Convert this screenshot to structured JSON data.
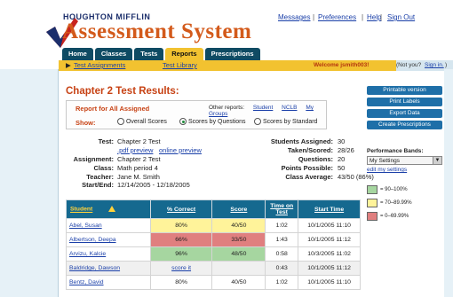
{
  "brand": {
    "small": "HOUGHTON MIFFLIN",
    "big": "Assessment System"
  },
  "top_links": {
    "messages": "Messages",
    "preferences": "Preferences",
    "help": "Help",
    "sign_out": "Sign Out",
    "separator": "|"
  },
  "tabs": [
    {
      "label": "Home"
    },
    {
      "label": "Classes"
    },
    {
      "label": "Tests"
    },
    {
      "label": "Reports"
    },
    {
      "label": "Prescriptions"
    }
  ],
  "subnav": {
    "test_assignments": "Test Assignments",
    "test_library": "Test Library",
    "welcome": "Welcome jsmith003!",
    "not_you_prefix": "(Not you?",
    "sign_in": "Sign in.",
    "not_you_suffix": ")"
  },
  "page_title": "Chapter 2 Test Results:",
  "report_box": {
    "title": "Report for All Assigned",
    "other_reports_label": "Other reports:",
    "other_reports": [
      "Student",
      "NCLB",
      "My Groups"
    ],
    "show_label": "Show:",
    "options": [
      "Overall Scores",
      "Scores by Questions",
      "Scores by Standard"
    ],
    "selected": "Scores by Questions"
  },
  "actions": [
    "Printable version",
    "Print Labels",
    "Export Data",
    "Create Prescriptions"
  ],
  "info_left": {
    "test_label": "Test:",
    "test_value": "Chapter 2 Test",
    "pdf_preview": ".pdf preview",
    "online_preview": "online preview",
    "assignment_label": "Assignment:",
    "assignment_value": "Chapter 2 Test",
    "class_label": "Class:",
    "class_value": "Math period 4",
    "teacher_label": "Teacher:",
    "teacher_value": "Jane M. Smith",
    "dates_label": "Start/End:",
    "dates_value": "12/14/2005 - 12/18/2005"
  },
  "info_right": {
    "assigned_label": "Students Assigned:",
    "assigned_value": "30",
    "taken_label": "Taken/Scored:",
    "taken_value": "28/26",
    "questions_label": "Questions:",
    "questions_value": "20",
    "points_label": "Points Possible:",
    "points_value": "50",
    "average_label": "Class Average:",
    "average_value": "43/50 (86%)"
  },
  "performance": {
    "title": "Performance Bands:",
    "selected": "My Settings",
    "edit": "edit my settings",
    "bands": [
      {
        "label": "= 90–100%",
        "color": "#a6d6a0"
      },
      {
        "label": "= 70–89.99%",
        "color": "#fff39a"
      },
      {
        "label": "= 0–69.99%",
        "color": "#e07f7f"
      }
    ]
  },
  "table": {
    "headers": [
      "Student",
      "% Correct",
      "Score",
      "Time on Test",
      "Start Time"
    ],
    "rows": [
      {
        "student": "Abel, Susan",
        "pct": "80%",
        "score": "40/50",
        "time": "1:02",
        "start": "10/1/2005 11:10",
        "band": "yellow"
      },
      {
        "student": "Albertson, Deepa",
        "pct": "66%",
        "score": "33/50",
        "time": "1:43",
        "start": "10/1/2005 11:12",
        "band": "red"
      },
      {
        "student": "Arvizu, Kalcie",
        "pct": "96%",
        "score": "48/50",
        "time": "0:58",
        "start": "10/3/2005 11:02",
        "band": "green"
      },
      {
        "student": "Baldridge, Dawson",
        "pct": "score it",
        "score": "",
        "time": "0:43",
        "start": "10/1/2005 11:12",
        "band": "gray"
      },
      {
        "student": "Bentz, David",
        "pct": "80%",
        "score": "40/50",
        "time": "1:02",
        "start": "10/1/2005 11:10",
        "band": "yellow"
      }
    ]
  },
  "colors": {
    "accent": "#d35a1b",
    "nav": "#0f4b63",
    "highlight": "#f2c230",
    "button": "#1e6fa8",
    "header_row": "#15698f"
  }
}
